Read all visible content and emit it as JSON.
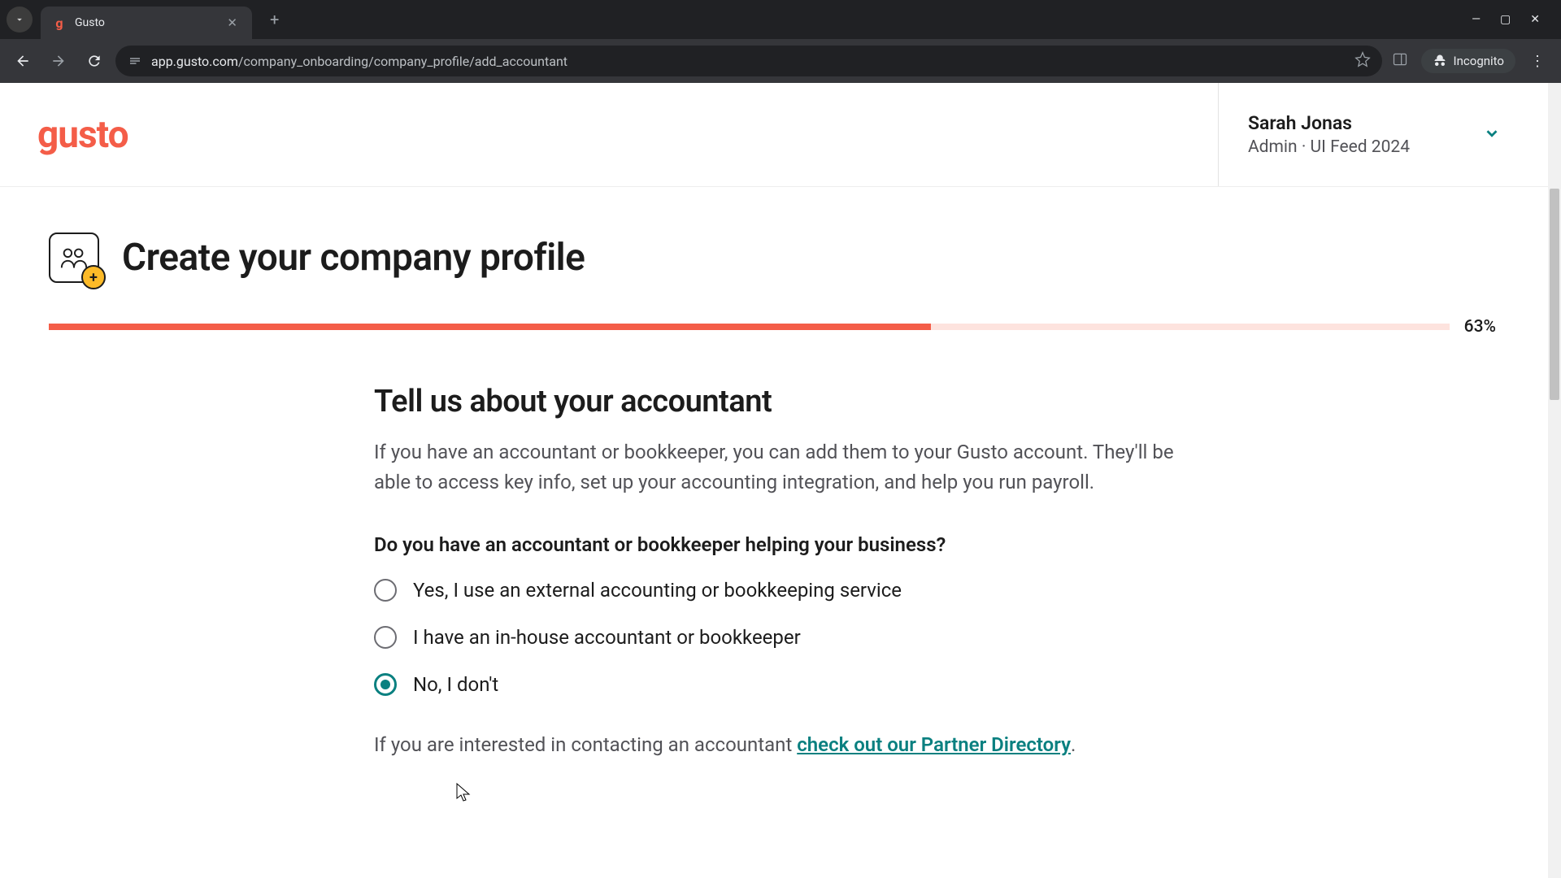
{
  "browser": {
    "tab_title": "Gusto",
    "url_display_domain": "app.gusto.com",
    "url_display_path": "/company_onboarding/company_profile/add_accountant",
    "incognito_label": "Incognito"
  },
  "header": {
    "logo_text": "gusto",
    "user_name": "Sarah Jonas",
    "user_role": "Admin · UI Feed 2024"
  },
  "page": {
    "title": "Create your company profile",
    "progress_pct": 63,
    "progress_label": "63%"
  },
  "section": {
    "heading": "Tell us about your accountant",
    "description": "If you have an accountant or bookkeeper, you can add them to your Gusto account. They'll be able to access key info, set up your accounting integration, and help you run payroll.",
    "question": "Do you have an accountant or bookkeeper helping your business?",
    "options": [
      {
        "label": "Yes, I use an external accounting or bookkeeping service",
        "selected": false
      },
      {
        "label": "I have an in-house accountant or bookkeeper",
        "selected": false
      },
      {
        "label": "No, I don't",
        "selected": true
      }
    ],
    "footnote_prefix": "If you are interested in contacting an accountant ",
    "footnote_link": "check out our Partner Directory",
    "footnote_suffix": "."
  }
}
